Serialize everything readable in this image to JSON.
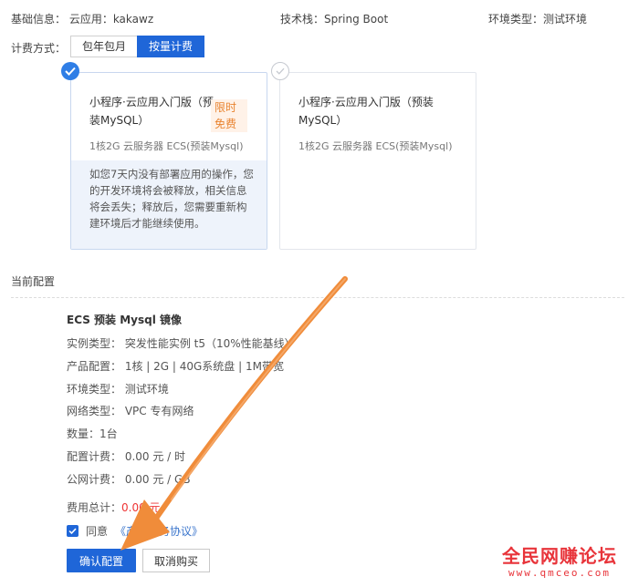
{
  "basic": {
    "basic_info": "基础信息：  云应用：kakawz",
    "tech_stack": "技术栈：Spring Boot",
    "env_type": "环境类型：测试环境"
  },
  "billing": {
    "label": "计费方式：",
    "options": [
      "包年包月",
      "按量计费"
    ],
    "selected": "按量计费"
  },
  "cards": [
    {
      "title": "小程序·云应用入门版（预装MySQL）",
      "promo": "限时免费",
      "spec": "1核2G 云服务器 ECS(预装Mysql)",
      "note": "如您7天内没有部署应用的操作，您的开发环境将会被释放，相关信息将会丢失；释放后，您需要重新构建环境后才能继续使用。",
      "selected": true
    },
    {
      "title": "小程序·云应用入门版（预装MySQL）",
      "spec": "1核2G 云服务器 ECS(预装Mysql)",
      "selected": false
    }
  ],
  "current": {
    "label": "当前配置",
    "heading": "ECS 预装 Mysql 镜像",
    "lines": [
      "实例类型：  突发性能实例 t5（10%性能基线）",
      "产品配置：  1核 | 2G | 40G系统盘 | 1M带宽",
      "环境类型：  测试环境",
      "网络类型：  VPC 专有网络",
      "数量：1台",
      "配置计费：  0.00 元 / 时",
      "公网计费：  0.00 元 / GB"
    ]
  },
  "total": {
    "label": "费用总计：",
    "amount": "0.00 元"
  },
  "agreement": {
    "prefix": "同意",
    "link": "《产品服务协议》",
    "checked": true
  },
  "actions": {
    "confirm": "确认配置",
    "cancel": "取消购买"
  },
  "watermark": {
    "cn": "全民网赚论坛",
    "url": "www.qmceo.com"
  },
  "colors": {
    "accent": "#1f66d8",
    "arrow": "#f08c3a",
    "promo": "#e9832f",
    "watermark": "#e8343a"
  }
}
